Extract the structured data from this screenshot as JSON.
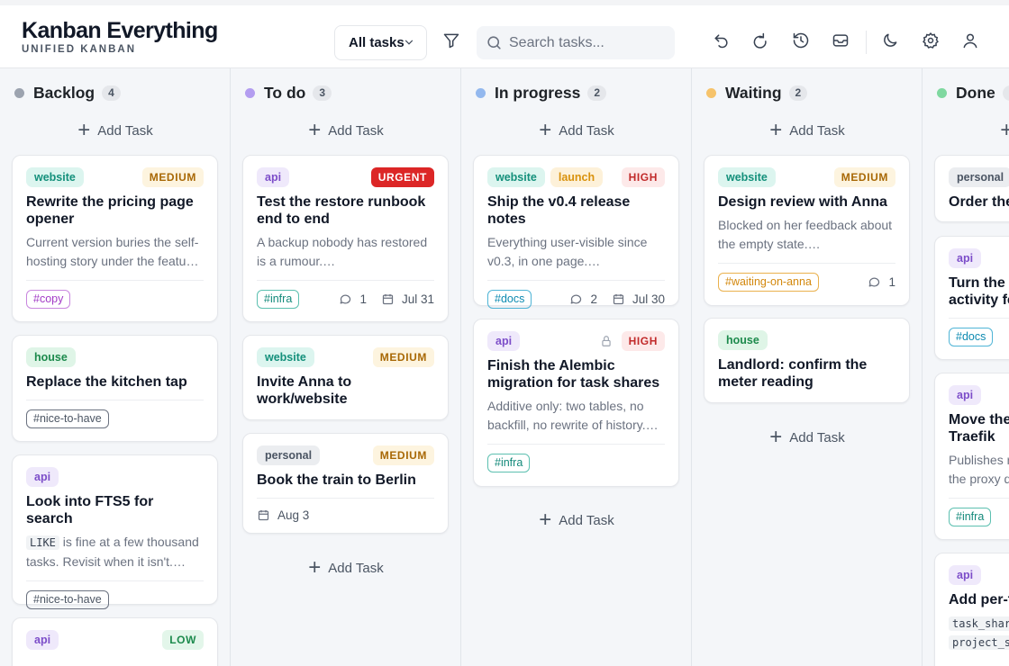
{
  "header": {
    "app_title": "Kanban Everything",
    "app_subtitle": "UNIFIED KANBAN",
    "filter_value": "All tasks",
    "search_placeholder": "Search tasks..."
  },
  "icons": [
    "chevron-down-icon",
    "filter-icon",
    "search-icon",
    "undo-icon",
    "redo-icon",
    "history-icon",
    "inbox-icon",
    "moon-icon",
    "settings-icon",
    "user-icon",
    "plus-icon",
    "comment-icon",
    "calendar-icon",
    "lock-icon"
  ],
  "add_task_label": "Add Task",
  "colors": {
    "backlog": "#9ca3af",
    "todo": "#b39df0",
    "in_progress": "#93b8ee",
    "waiting": "#f6c36b",
    "done": "#7fd8a0"
  },
  "columns": [
    {
      "title": "Backlog",
      "count": "4",
      "cards": [
        {
          "project": "website",
          "priority": "MEDIUM",
          "title": "Rewrite the pricing page opener",
          "desc": "Current version buries the self-hosting story under the featu…",
          "labels": [
            "#copy"
          ]
        },
        {
          "project": "house",
          "title": "Replace the kitchen tap",
          "labels": [
            "#nice-to-have"
          ]
        },
        {
          "project": "api",
          "title": "Look into FTS5 for search",
          "desc_code": "LIKE",
          "desc": " is fine at a few thousand tasks. Revisit when it isn't.…",
          "labels": [
            "#nice-to-have"
          ]
        },
        {
          "project": "api",
          "priority": "LOW"
        }
      ]
    },
    {
      "title": "To do",
      "count": "3",
      "cards": [
        {
          "project": "api",
          "priority": "URGENT",
          "title": "Test the restore runbook end to end",
          "desc": "A backup nobody has restored is a rumour.…",
          "labels": [
            "#infra"
          ],
          "comments": "1",
          "due": "Jul 31"
        },
        {
          "project": "website",
          "priority": "MEDIUM",
          "title": "Invite Anna to work/website"
        },
        {
          "project": "personal",
          "priority": "MEDIUM",
          "title": "Book the train to Berlin",
          "due": "Aug 3"
        }
      ]
    },
    {
      "title": "In progress",
      "count": "2",
      "cards": [
        {
          "project": "website",
          "project2": "launch",
          "priority": "HIGH",
          "title": "Ship the v0.4 release notes",
          "desc": "Everything user-visible since v0.3, in one page.…",
          "labels": [
            "#docs"
          ],
          "comments": "2",
          "due": "Jul 30"
        },
        {
          "project": "api",
          "priority": "HIGH",
          "title": "Finish the Alembic migration for task shares",
          "desc": "Additive only: two tables, no backfill, no rewrite of history.…",
          "labels": [
            "#infra"
          ]
        }
      ]
    },
    {
      "title": "Waiting",
      "count": "2",
      "cards": [
        {
          "project": "website",
          "priority": "MEDIUM",
          "title": "Design review with Anna",
          "desc": "Blocked on her feedback about the empty state.…",
          "labels": [
            "#waiting-on-anna"
          ],
          "comments": "1"
        },
        {
          "project": "house",
          "title": "Landlord: confirm the meter reading"
        }
      ]
    },
    {
      "title": "Done",
      "cards": [
        {
          "project": "personal",
          "title": "Order the"
        },
        {
          "project": "api",
          "title": "Turn the a activity fe",
          "labels": [
            "#docs"
          ]
        },
        {
          "project": "api",
          "title": "Move the Traefik",
          "desc": "Publishes r the proxy d",
          "labels": [
            "#infra"
          ]
        },
        {
          "project": "api",
          "title": "Add per-t",
          "code1": "task_shar",
          "code2": "project_s"
        }
      ]
    }
  ]
}
